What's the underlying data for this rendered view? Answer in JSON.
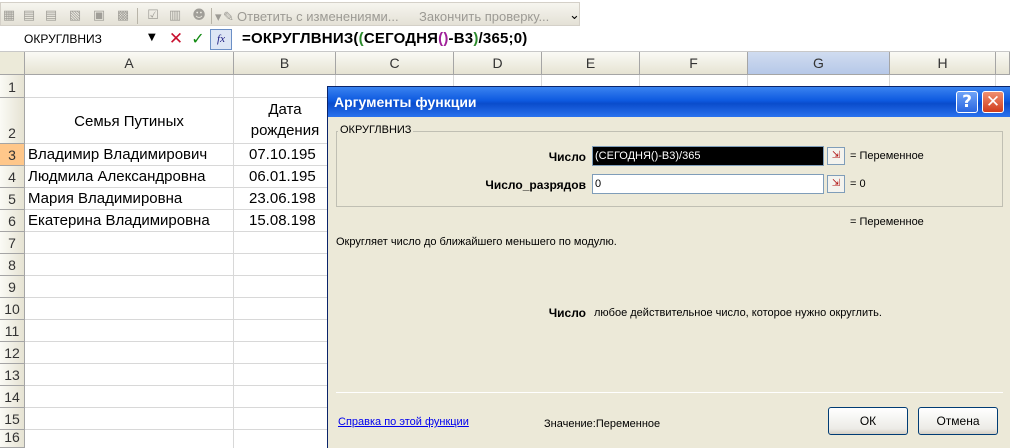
{
  "toolbar": {
    "reply_text": "Ответить с изменениями...",
    "finish_text": "Закончить проверку...",
    "dropdown_glyph": "▾",
    "more_glyph": "⌄"
  },
  "formula_bar": {
    "name_box": "ОКРУГЛВНИЗ",
    "name_arrow": "▼",
    "cancel_glyph": "✕",
    "enter_glyph": "✓",
    "fx_label": "fx",
    "formula_parts": [
      {
        "text": "=ОКРУГЛВНИЗ(",
        "color": "#000000"
      },
      {
        "text": "(",
        "color": "#2a8a2a"
      },
      {
        "text": "СЕГОДНЯ",
        "color": "#000000"
      },
      {
        "text": "()",
        "color": "#a0209a"
      },
      {
        "text": "-B3",
        "color": "#000000"
      },
      {
        "text": ")",
        "color": "#2a8a2a"
      },
      {
        "text": "/365;0)",
        "color": "#000000"
      }
    ]
  },
  "sheet": {
    "columns": [
      "A",
      "B",
      "C",
      "D",
      "E",
      "F",
      "G",
      "H"
    ],
    "selected_column": "G",
    "rows": [
      "1",
      "2",
      "3",
      "4",
      "5",
      "6",
      "7",
      "8",
      "9",
      "10",
      "11",
      "12",
      "13",
      "14",
      "15",
      "16"
    ],
    "selected_row": "3",
    "header_a2": "Семья Путиных",
    "header_b2_line1": "Дата",
    "header_b2_line2": "рождения",
    "people": [
      {
        "name": "Владимир Владимирович",
        "date": "07.10.195"
      },
      {
        "name": "Людмила Александровна",
        "date": "06.01.195"
      },
      {
        "name": "Мария Владимировна",
        "date": "23.06.198"
      },
      {
        "name": "Екатерина Владимировна",
        "date": "15.08.198"
      }
    ]
  },
  "dialog": {
    "title": "Аргументы функции",
    "help_glyph": "?",
    "close_glyph": "✕",
    "group_label": "ОКРУГЛВНИЗ",
    "args": [
      {
        "label": "Число",
        "value": "(СЕГОДНЯ()-B3)/365",
        "result": "= Переменное"
      },
      {
        "label": "Число_разрядов",
        "value": "0",
        "result": "= 0"
      }
    ],
    "collapse_glyph": "⇲",
    "overall_result": "= Переменное",
    "description": "Округляет число до ближайшего меньшего по модулю.",
    "arg_desc_label": "Число",
    "arg_desc_text": "любое действительное число, которое нужно округлить.",
    "help_link": "Справка по этой функции",
    "value_label": "Значение:",
    "value_text": "Переменное",
    "ok_label": "ОК",
    "cancel_label": "Отмена"
  }
}
